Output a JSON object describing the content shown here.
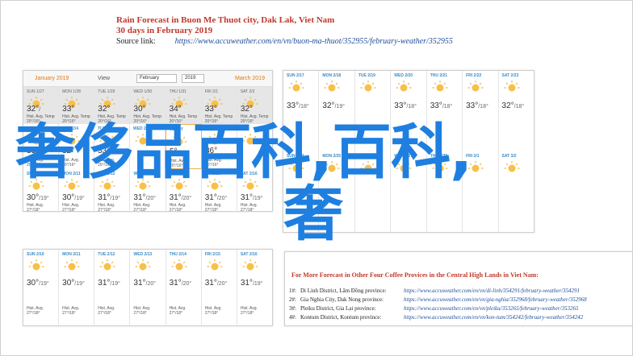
{
  "header": {
    "title": "Rain Forecast in Buon Me Thuot city, Dak Lak, Viet Nam",
    "subtitle": "30 days in February 2019",
    "source_label": "Source link:",
    "source_url": "https://www.accuweather.com/en/vn/buon-ma-thuot/352955/february-weather/352955"
  },
  "calendar": {
    "prev_month": "January 2019",
    "view_label": "View",
    "month_select": "February",
    "year_select": "2019",
    "next_month": "March 2019",
    "row1": [
      {
        "day": "SUN 1/27",
        "temp": "32°",
        "lo": "/",
        "desc": "Hist. Avg. Temp\n20°/16°"
      },
      {
        "day": "MON 1/28",
        "temp": "33°",
        "lo": "",
        "desc": "Hist. Avg. Temp\n20°/16°"
      },
      {
        "day": "TUE 1/29",
        "temp": "32°",
        "lo": "",
        "desc": "Hist. Avg. Temp\n20°/16°"
      },
      {
        "day": "WED 1/30",
        "temp": "30°",
        "lo": "",
        "desc": "Hist. Avg. Temp\n20°/16°"
      },
      {
        "day": "THU 1/31",
        "temp": "34°",
        "lo": "",
        "desc": "Hist. Avg. Temp\n20°/16°"
      },
      {
        "day": "FRI 2/1",
        "temp": "33°",
        "lo": "",
        "desc": "Hist. Avg. Temp\n20°/16°"
      },
      {
        "day": "SAT 2/2",
        "temp": "32°",
        "lo": "",
        "desc": "Hist. Avg. Temp\n20°/16°"
      }
    ],
    "row2": [
      {
        "day": "SUN 2/3",
        "temp": "33°",
        "lo": "",
        "desc": "Hist. Avg.\n20°/16°"
      },
      {
        "day": "MON 2/4",
        "temp": "32°",
        "lo": "",
        "desc": "Hist. Avg.\n20°/16°"
      },
      {
        "day": "TUE 2/5",
        "temp": "33°",
        "lo": "",
        "desc": "Hist. Avg.\n20°/16°"
      },
      {
        "day": "WED 2/6",
        "temp": "",
        "lo": "",
        "desc": ""
      },
      {
        "day": "TODAY",
        "temp": "5°",
        "lo": "",
        "desc": "Hist. Avg.\n20°/16°"
      },
      {
        "day": "",
        "temp": "36°",
        "lo": "",
        "desc": "Hist. Avg.\n20°/16°"
      },
      {
        "day": "",
        "temp": "",
        "lo": "",
        "desc": ""
      }
    ],
    "row3": [
      {
        "day": "SUN 2/10",
        "temp": "30°",
        "lo": "/19°",
        "desc": "Hist. Avg.\n27°/18°"
      },
      {
        "day": "MON 2/11",
        "temp": "30°",
        "lo": "/19°",
        "desc": "Hist. Avg.\n27°/18°"
      },
      {
        "day": "TUE 2/12",
        "temp": "31°",
        "lo": "/19°",
        "desc": "Hist. Avg.\n27°/18°"
      },
      {
        "day": "WED 2/13",
        "temp": "31°",
        "lo": "/20°",
        "desc": "Hist. Avg.\n27°/18°"
      },
      {
        "day": "THU 2/14",
        "temp": "31°",
        "lo": "/20°",
        "desc": "Hist. Avg.\n27°/18°"
      },
      {
        "day": "FRI 2/15",
        "temp": "31°",
        "lo": "/20°",
        "desc": "Hist. Avg.\n27°/18°"
      },
      {
        "day": "SAT 2/16",
        "temp": "31°",
        "lo": "/19°",
        "desc": "Hist. Avg.\n27°/18°"
      }
    ],
    "right_row1": [
      {
        "day": "SUN 2/17",
        "temp": "33°",
        "lo": "/18°"
      },
      {
        "day": "MON 2/18",
        "temp": "32°",
        "lo": "/19°"
      },
      {
        "day": "TUE 2/19",
        "temp": "",
        "lo": ""
      },
      {
        "day": "WED 2/20",
        "temp": "33°",
        "lo": "/18°"
      },
      {
        "day": "THU 2/21",
        "temp": "33°",
        "lo": "/18°"
      },
      {
        "day": "FRI 2/22",
        "temp": "33°",
        "lo": "/18°"
      },
      {
        "day": "SAT 2/23",
        "temp": "32°",
        "lo": "/18°"
      }
    ],
    "right_row2": [
      {
        "day": "SUN 2/24",
        "temp": "",
        "lo": ""
      },
      {
        "day": "MON 2/25",
        "temp": "",
        "lo": ""
      },
      {
        "day": "TUE 2/26",
        "temp": "",
        "lo": ""
      },
      {
        "day": "WED 2/27",
        "temp": "",
        "lo": ""
      },
      {
        "day": "THU 2/28",
        "temp": "",
        "lo": ""
      },
      {
        "day": "FRI 3/1",
        "temp": "",
        "lo": ""
      },
      {
        "day": "SAT 3/2",
        "temp": "",
        "lo": ""
      }
    ]
  },
  "more_forecast": {
    "title": "For More Forecast in Other Four Coffee Provices in the Central High Lands in Viet Nam:",
    "links": [
      {
        "n": "1#:",
        "name": "Di Linh District, Lâm Đồng province:",
        "url": "https://www.accuweather.com/en/vn/di-linh/354291/february-weather/354291"
      },
      {
        "n": "2#:",
        "name": "Gia Nghia City, Dak Nong province:",
        "url": "https://www.accuweather.com/en/vn/gia-nghia/352968/february-weather/352968"
      },
      {
        "n": "3#:",
        "name": "Pleiku District, Gia Lai province:",
        "url": "https://www.accuweather.com/en/vn/pleiku/353265/february-weather/353265"
      },
      {
        "n": "4#:",
        "name": "Kontum District, Kontum province:",
        "url": "https://www.accuweather.com/en/vn/kon-tum/354242/february-weather/354242"
      }
    ]
  },
  "overlay": {
    "line1": "奢侈品百科,百科,",
    "line2": "奢"
  }
}
